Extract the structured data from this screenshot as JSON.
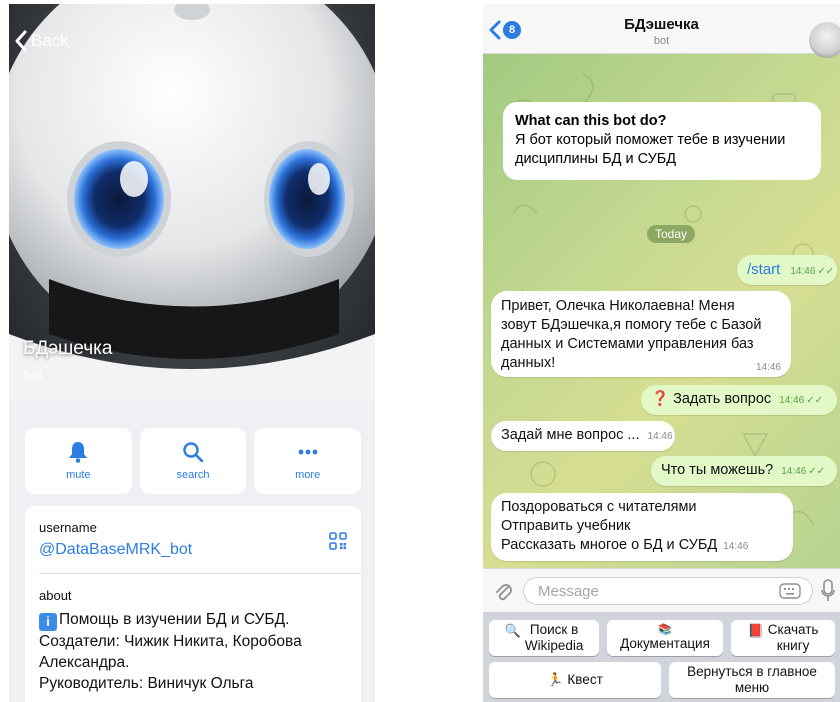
{
  "profile": {
    "back_label": "Back",
    "name": "БДэшечка",
    "subtitle": "bot",
    "actions": [
      {
        "icon": "bell-icon",
        "label": "mute"
      },
      {
        "icon": "search-icon",
        "label": "search"
      },
      {
        "icon": "more-icon",
        "label": "more"
      }
    ],
    "username_caption": "username",
    "username": "@DataBaseMRK_bot",
    "about_caption": "about",
    "about_badge": "i",
    "about_lines": [
      "Помощь в изучении БД и СУБД.",
      "Создатели: Чижик Никита, Коробова",
      "Александра.",
      "Руководитель: Виничук Ольга"
    ]
  },
  "chat": {
    "unread_count": "8",
    "title": "БДэшечка",
    "status": "bot",
    "intro_title": "What can this bot do?",
    "intro_lines": [
      "Я бот который поможет тебе в изучении",
      "дисциплины БД и СУБД"
    ],
    "date_badge": "Today",
    "messages": [
      {
        "dir": "out",
        "text": "/start",
        "time": "14:46"
      },
      {
        "dir": "in",
        "lines": [
          "Привет, Олечка Николаевна! Меня",
          "зовут БДэшечка,я помогу тебе с Базой",
          "данных и Системами управления баз",
          "данных!"
        ],
        "time": "14:46"
      },
      {
        "dir": "out",
        "emoji": "❓",
        "text": "Задать вопрос",
        "time": "14:46"
      },
      {
        "dir": "in",
        "text": "Задай мне вопрос ...",
        "time": "14:46"
      },
      {
        "dir": "out",
        "text": "Что ты можешь?",
        "time": "14:46"
      },
      {
        "dir": "in",
        "lines": [
          "Поздороваться с читателями",
          "Отправить учебник",
          "Рассказать многое о БД и СУБД"
        ],
        "time": "14:46"
      }
    ],
    "input_placeholder": "Message",
    "keyboard": [
      {
        "emoji": "🔍",
        "lines": [
          "Поиск в",
          "Wikipedia"
        ]
      },
      {
        "emoji": "📚",
        "lines": [
          "Документация"
        ]
      },
      {
        "emoji": "📕",
        "lines": [
          "Скачать",
          "книгу"
        ]
      },
      {
        "emoji": "🏃",
        "lines": [
          "Квест"
        ]
      },
      {
        "lines": [
          "Вернуться в главное",
          "меню"
        ]
      }
    ]
  },
  "colors": {
    "accent": "#2b7de1",
    "outgoing_bubble": "#e2f8c7",
    "incoming_bubble": "#ffffff",
    "keyboard_bg": "#d1d4db",
    "read_ticks": "#57a34a"
  }
}
